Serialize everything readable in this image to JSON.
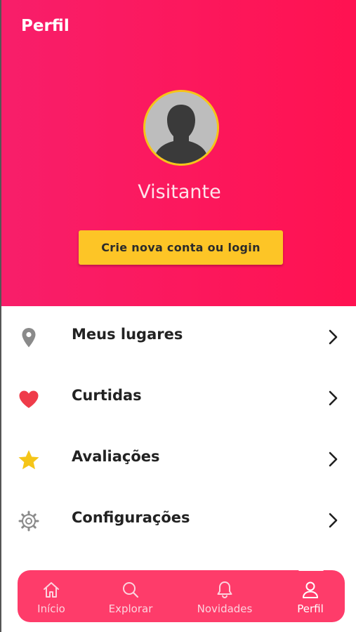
{
  "header": {
    "title": "Perfil"
  },
  "profile": {
    "name": "Visitante",
    "login_button": "Crie nova conta ou login",
    "avatar_icon": "person-silhouette-icon"
  },
  "menu": {
    "items": [
      {
        "label": "Meus lugares",
        "icon": "map-pin-icon",
        "icon_color": "#8a8a8a"
      },
      {
        "label": "Curtidas",
        "icon": "heart-icon",
        "icon_color": "#ef3c4a"
      },
      {
        "label": "Avaliações",
        "icon": "star-icon",
        "icon_color": "#f5c518"
      },
      {
        "label": "Configurações",
        "icon": "gear-icon",
        "icon_color": "#8a8a8a"
      }
    ]
  },
  "tabbar": {
    "tabs": [
      {
        "label": "Início",
        "icon": "home-icon"
      },
      {
        "label": "Explorar",
        "icon": "search-icon"
      },
      {
        "label": "Novidades",
        "icon": "bell-icon"
      },
      {
        "label": "Perfil",
        "icon": "user-icon",
        "active": true
      }
    ]
  },
  "colors": {
    "hero_gradient_start": "#f81e6a",
    "hero_gradient_end": "#ff1251",
    "accent_yellow": "#fdc526",
    "tabbar_bg": "#fe3c6a"
  }
}
